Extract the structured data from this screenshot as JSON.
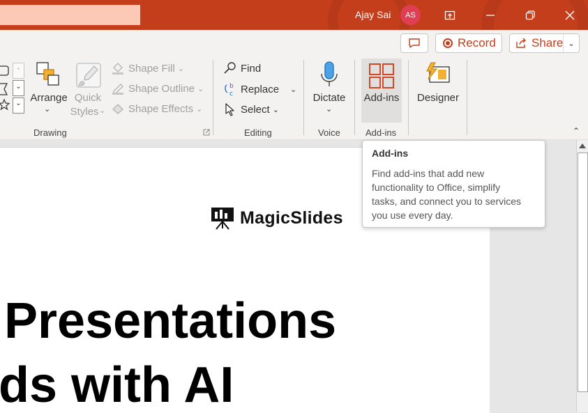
{
  "titlebar": {
    "user_name": "Ajay Sai",
    "avatar_initials": "AS",
    "accent_color": "#c43e1c",
    "buttons": {
      "ribbon_display": "ribbon-display-icon",
      "minimize": "minimize-icon",
      "restore": "restore-icon",
      "close": "close-icon"
    }
  },
  "commandbar": {
    "record_label": "Record",
    "share_label": "Share"
  },
  "ribbon": {
    "drawing": {
      "arrange_label": "Arrange",
      "quick_styles_line1": "Quick",
      "quick_styles_line2": "Styles",
      "shape_fill": "Shape Fill",
      "shape_outline": "Shape Outline",
      "shape_effects": "Shape Effects",
      "group_label": "Drawing"
    },
    "editing": {
      "find": "Find",
      "replace": "Replace",
      "select": "Select",
      "group_label": "Editing"
    },
    "voice": {
      "dictate": "Dictate",
      "group_label": "Voice"
    },
    "addins": {
      "addins_label": "Add-ins",
      "group_label": "Add-ins"
    },
    "designer": {
      "designer_label": "Designer"
    }
  },
  "tooltip": {
    "title": "Add-ins",
    "line1": "Find add-ins that add new",
    "line2": "functionality to Office, simplify",
    "line3": "tasks, and connect you to services",
    "line4": "you use every day."
  },
  "slide": {
    "logo_text": "MagicSlides",
    "title_line1": "Presentations",
    "title_line2": "ds with AI"
  }
}
